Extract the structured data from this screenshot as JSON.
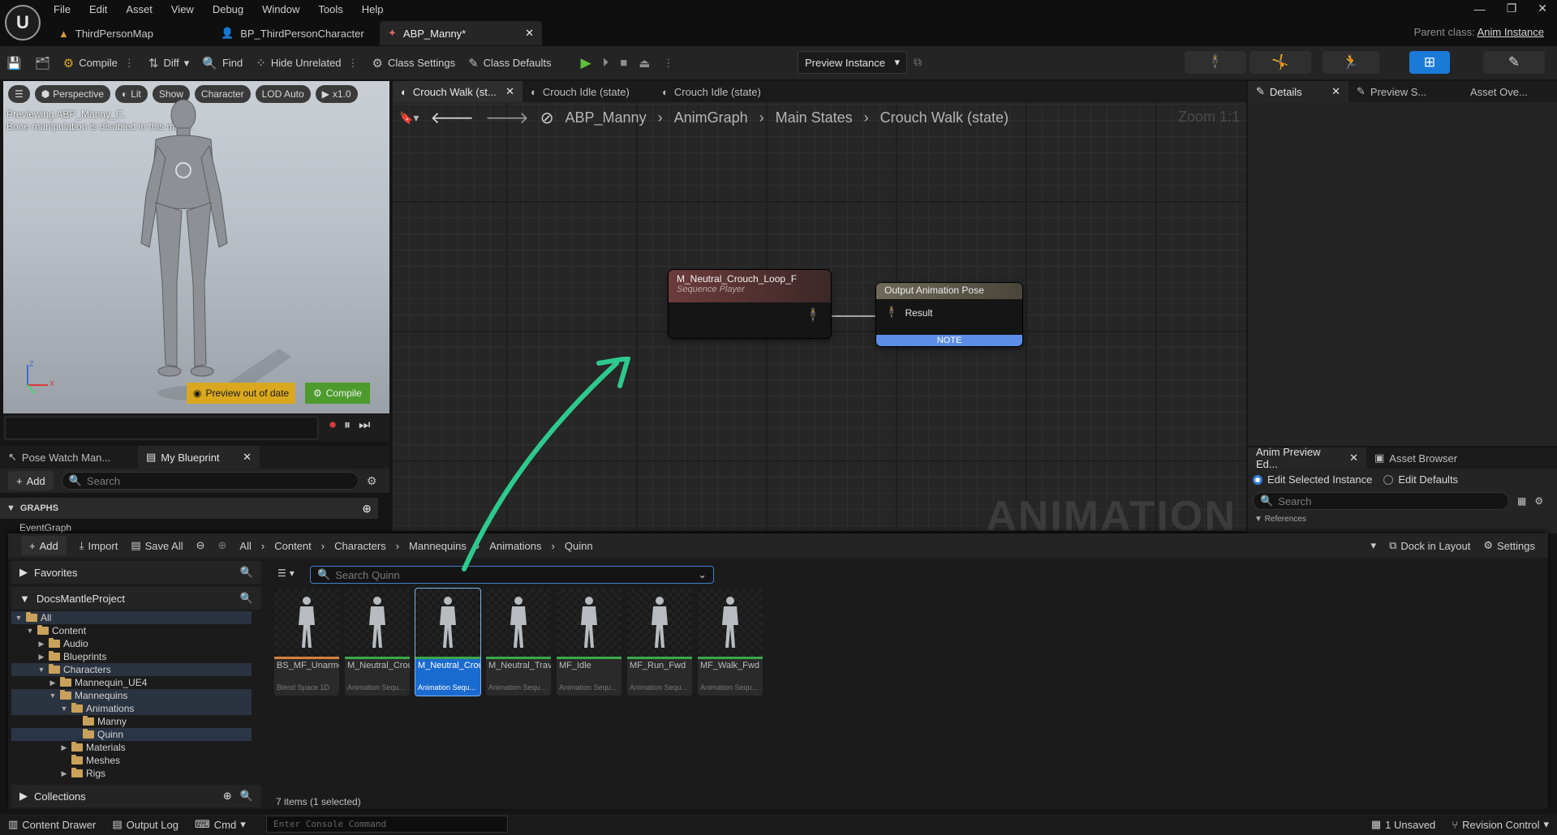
{
  "app": {
    "logo": "U",
    "menu": [
      "File",
      "Edit",
      "Asset",
      "View",
      "Debug",
      "Window",
      "Tools",
      "Help"
    ],
    "tabs": [
      {
        "label": "ThirdPersonMap",
        "icon": "level-icon"
      },
      {
        "label": "BP_ThirdPersonCharacter",
        "icon": "blueprint-icon"
      },
      {
        "label": "ABP_Manny*",
        "icon": "anim-blueprint-icon"
      }
    ],
    "parent_class_label": "Parent class:",
    "parent_class_value": "Anim Instance"
  },
  "toolbar": {
    "compile": "Compile",
    "diff": "Diff",
    "find": "Find",
    "hide_unrelated": "Hide Unrelated",
    "class_settings": "Class Settings",
    "class_defaults": "Class Defaults",
    "preview_instance": "Preview Instance"
  },
  "viewport": {
    "perspective": "Perspective",
    "lit": "Lit",
    "show": "Show",
    "character": "Character",
    "lod": "LOD Auto",
    "speed": "x1.0",
    "info_line1": "Previewing ABP_Manny_C.",
    "info_line2": "Bone manipulation is disabled in this mode.",
    "preview_out": "Preview out of date",
    "compile": "Compile",
    "axis_z": "Z",
    "axis_x": "X"
  },
  "left_panel": {
    "tab1": "Pose Watch Man...",
    "tab2": "My Blueprint",
    "add": "Add",
    "search_placeholder": "Search",
    "graphs": "GRAPHS",
    "event_graph": "EventGraph"
  },
  "graph": {
    "tabs": [
      "Crouch Walk (st...",
      "Crouch Idle (state)",
      "Crouch Idle (state)"
    ],
    "crumbs": [
      "ABP_Manny",
      "AnimGraph",
      "Main States",
      "Crouch Walk (state)"
    ],
    "zoom": "Zoom 1:1",
    "watermark": "ANIMATION",
    "seq_node_title": "M_Neutral_Crouch_Loop_F",
    "seq_node_sub": "Sequence Player",
    "out_node_title": "Output Animation Pose",
    "out_node_pin": "Result",
    "note": "NOTE"
  },
  "right_panel": {
    "tabs": [
      "Details",
      "Preview S...",
      "Asset Ove..."
    ],
    "tabs2": [
      "Anim Preview Ed...",
      "Asset Browser"
    ],
    "edit_selected": "Edit Selected Instance",
    "edit_defaults": "Edit Defaults",
    "search_placeholder": "Search",
    "references": "References"
  },
  "content_drawer": {
    "add": "Add",
    "import": "Import",
    "save_all": "Save All",
    "path": [
      "All",
      "Content",
      "Characters",
      "Mannequins",
      "Animations",
      "Quinn"
    ],
    "dock": "Dock in Layout",
    "settings": "Settings",
    "favorites": "Favorites",
    "project": "DocsMantleProject",
    "collections": "Collections",
    "search_placeholder": "Search Quinn",
    "tree": [
      {
        "label": "All",
        "depth": 0,
        "caret": "▼",
        "state": "sel"
      },
      {
        "label": "Content",
        "depth": 1,
        "caret": "▼",
        "state": ""
      },
      {
        "label": "Audio",
        "depth": 2,
        "caret": "▶",
        "state": ""
      },
      {
        "label": "Blueprints",
        "depth": 2,
        "caret": "▶",
        "state": ""
      },
      {
        "label": "Characters",
        "depth": 2,
        "caret": "▼",
        "state": "sel"
      },
      {
        "label": "Mannequin_UE4",
        "depth": 3,
        "caret": "▶",
        "state": ""
      },
      {
        "label": "Mannequins",
        "depth": 3,
        "caret": "▼",
        "state": "sel"
      },
      {
        "label": "Animations",
        "depth": 4,
        "caret": "▼",
        "state": "sel"
      },
      {
        "label": "Manny",
        "depth": 5,
        "caret": "",
        "state": ""
      },
      {
        "label": "Quinn",
        "depth": 5,
        "caret": "",
        "state": "hl"
      },
      {
        "label": "Materials",
        "depth": 4,
        "caret": "▶",
        "state": ""
      },
      {
        "label": "Meshes",
        "depth": 4,
        "caret": "",
        "state": ""
      },
      {
        "label": "Rigs",
        "depth": 4,
        "caret": "▶",
        "state": ""
      }
    ],
    "assets": [
      {
        "name": "BS_MF_Unarmed_...",
        "type": "Blend Space 1D",
        "bar": "#d4823a",
        "selected": false
      },
      {
        "name": "M_Neutral_Crouch_Idle_...",
        "type": "Animation Sequ...",
        "bar": "#3aa84a",
        "selected": false
      },
      {
        "name": "M_Neutral_Crouch_Loop_...",
        "type": "Animation Sequ...",
        "bar": "#3aa84a",
        "selected": true
      },
      {
        "name": "M_Neutral_Traversal_...",
        "type": "Animation Sequ...",
        "bar": "#3aa84a",
        "selected": false
      },
      {
        "name": "MF_Idle",
        "type": "Animation Sequ...",
        "bar": "#3aa84a",
        "selected": false
      },
      {
        "name": "MF_Run_Fwd",
        "type": "Animation Sequ...",
        "bar": "#3aa84a",
        "selected": false
      },
      {
        "name": "MF_Walk_Fwd",
        "type": "Animation Sequ...",
        "bar": "#3aa84a",
        "selected": false
      }
    ],
    "item_count": "7 items (1 selected)"
  },
  "statusbar": {
    "content_drawer": "Content Drawer",
    "output_log": "Output Log",
    "cmd": "Cmd",
    "console_placeholder": "Enter Console Command",
    "unsaved": "1 Unsaved",
    "revision": "Revision Control"
  },
  "colors": {
    "accent": "#1a7ad8",
    "arrow": "#2ec98f",
    "warning": "#d9a81e",
    "success": "#4d9b2c"
  }
}
